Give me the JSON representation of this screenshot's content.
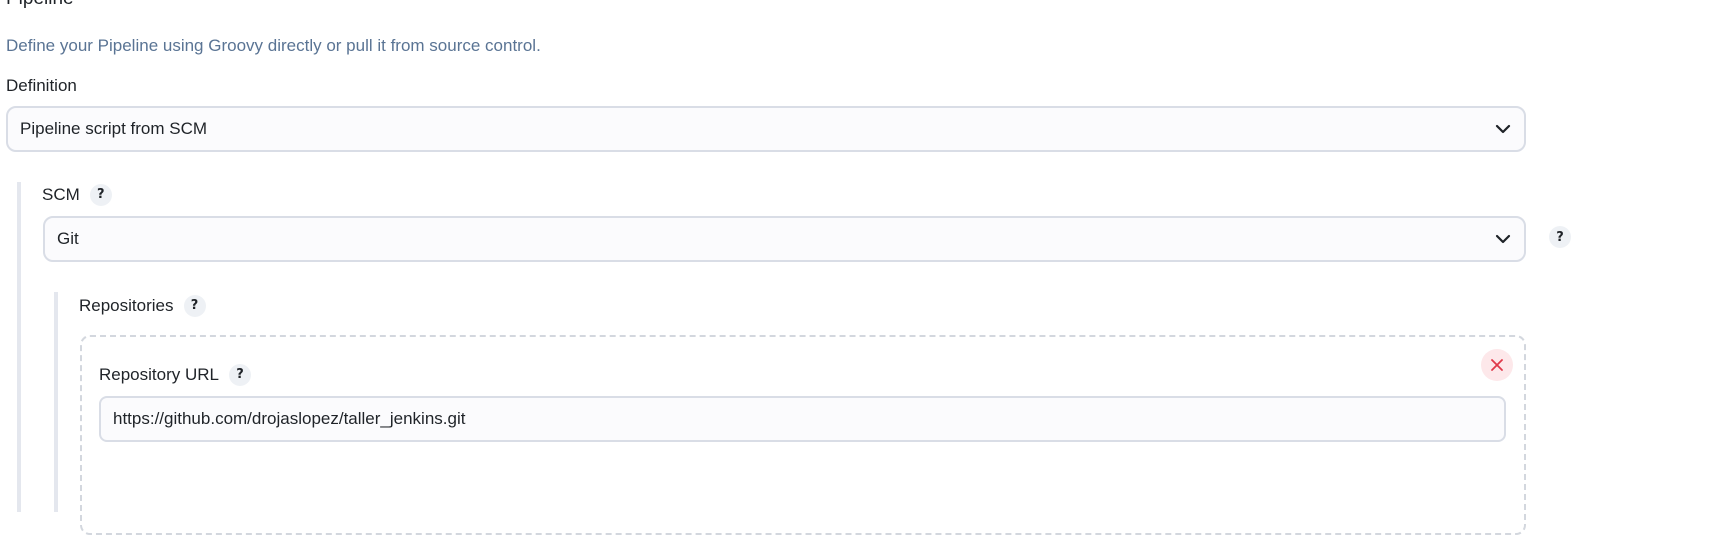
{
  "section": {
    "title": "Pipeline",
    "description": "Define your Pipeline using Groovy directly or pull it from source control."
  },
  "definition": {
    "label": "Definition",
    "selected": "Pipeline script from SCM"
  },
  "scm": {
    "label": "SCM",
    "help": "?",
    "selected": "Git",
    "side_help": "?"
  },
  "repositories": {
    "label": "Repositories",
    "help": "?"
  },
  "repository_url": {
    "label": "Repository URL",
    "help": "?",
    "value": "https://github.com/drojaslopez/taller_jenkins.git"
  },
  "colors": {
    "description_text": "#5a7494",
    "delete_icon": "#e0394a",
    "delete_bg": "#fde8ea"
  },
  "icons": {
    "dropdown": "chevron-down-icon",
    "delete": "close-icon"
  }
}
